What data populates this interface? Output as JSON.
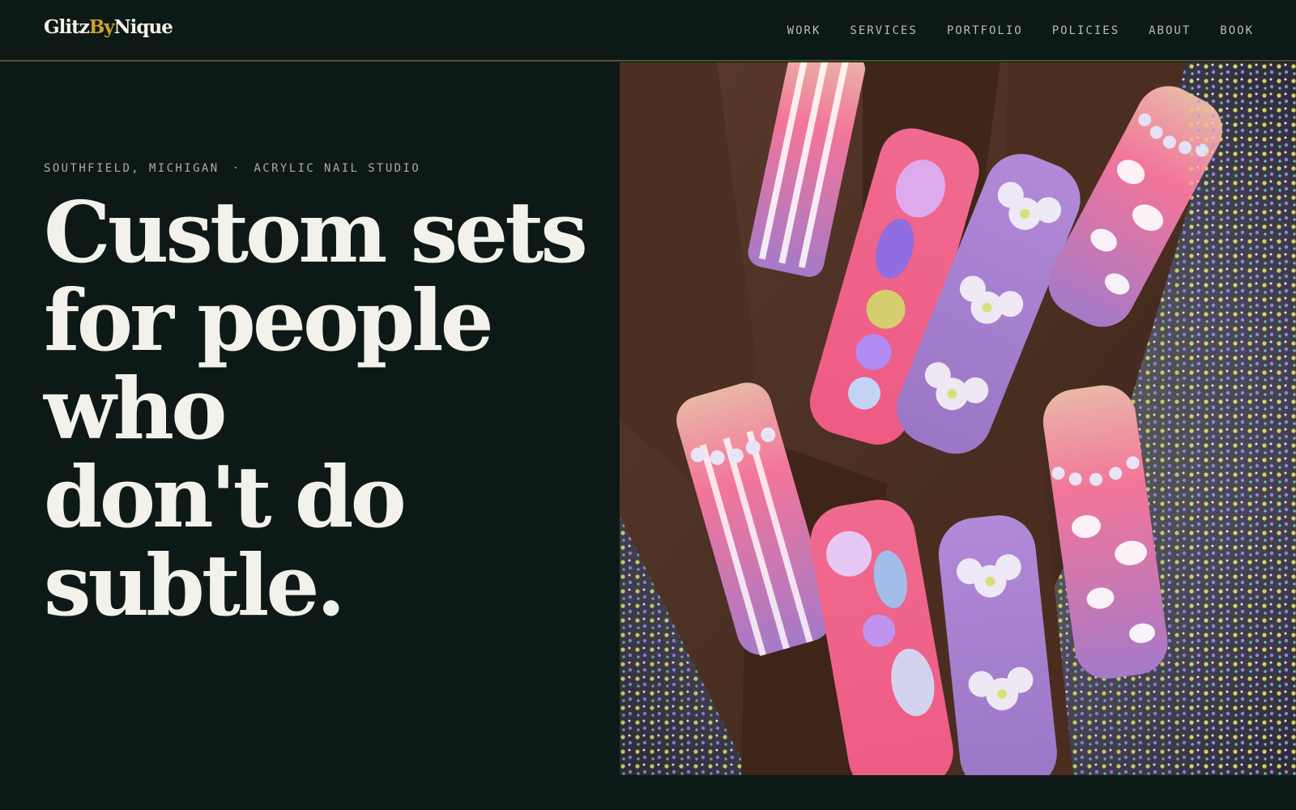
{
  "brand": {
    "part1": "Glitz",
    "part2": "By",
    "part3": "Nique"
  },
  "nav": [
    {
      "label": "WORK"
    },
    {
      "label": "SERVICES"
    },
    {
      "label": "PORTFOLIO"
    },
    {
      "label": "POLICIES"
    },
    {
      "label": "ABOUT"
    },
    {
      "label": "BOOK"
    }
  ],
  "hero": {
    "location": "SOUTHFIELD, MICHIGAN",
    "separator": "·",
    "category": "ACRYLIC NAIL STUDIO",
    "headline_lines": [
      "Custom sets",
      "for people",
      "who",
      "don't do",
      "subtle."
    ]
  },
  "colors": {
    "background": "#0d1916",
    "accent": "#c9a227",
    "divider": "#4a5526",
    "text": "#f3f2ea"
  }
}
